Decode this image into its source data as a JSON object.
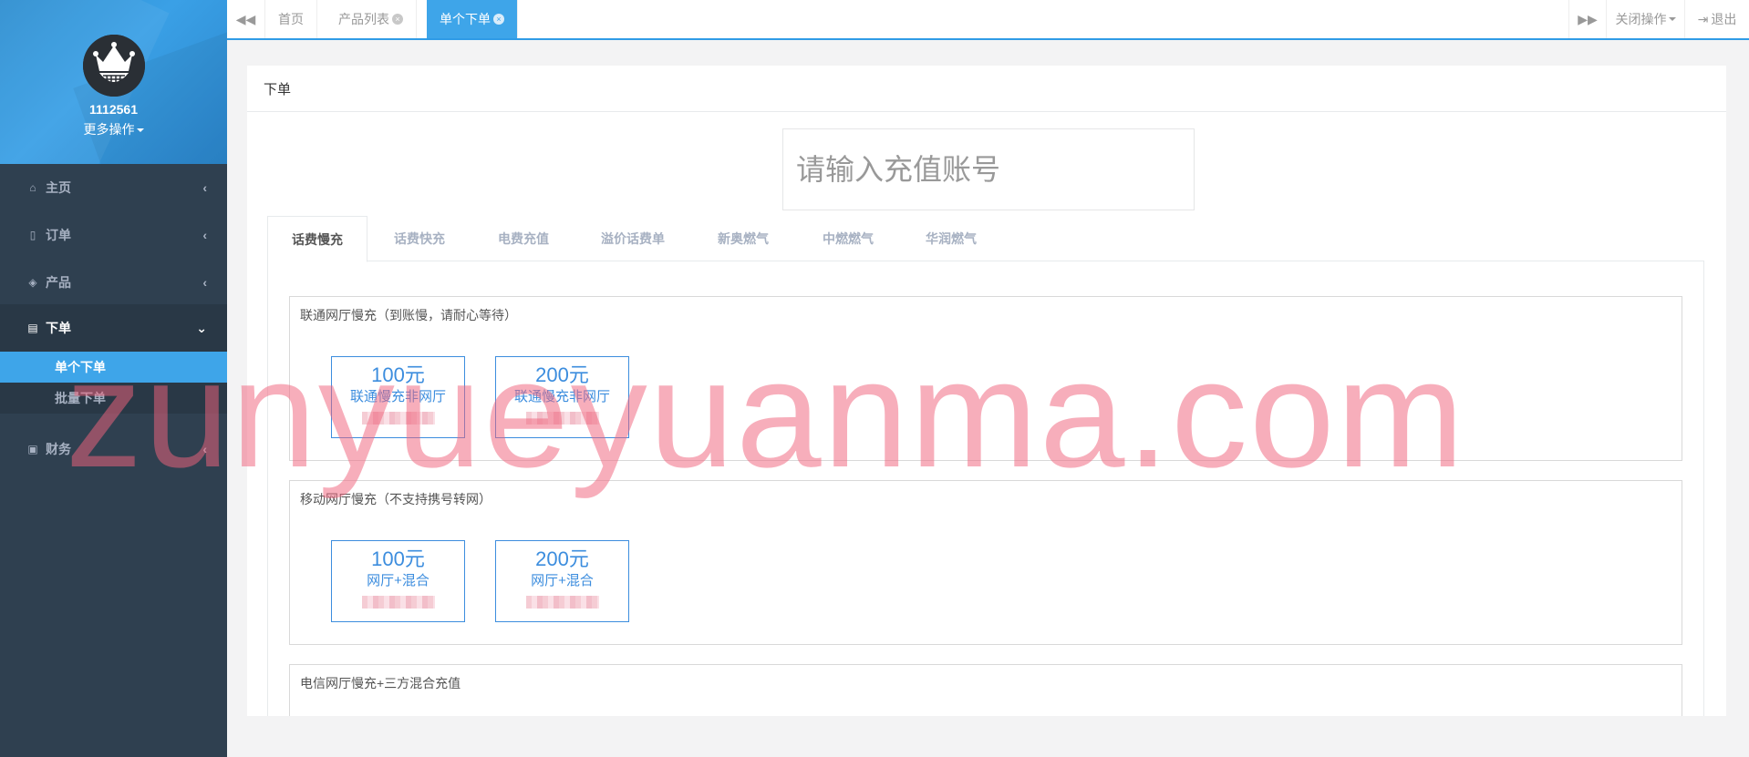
{
  "user": {
    "name": "1112561",
    "more_ops": "更多操作"
  },
  "sidebar": {
    "items": [
      {
        "label": "主页",
        "icon": "home-icon",
        "chevron": "‹"
      },
      {
        "label": "订单",
        "icon": "file-icon",
        "chevron": "‹"
      },
      {
        "label": "产品",
        "icon": "cube-icon",
        "chevron": "‹"
      },
      {
        "label": "下单",
        "icon": "file-text-icon",
        "chevron": "⌄",
        "expanded": true
      },
      {
        "label": "财务",
        "icon": "money-icon",
        "chevron": "‹"
      }
    ],
    "sub_items": [
      {
        "label": "单个下单",
        "selected": true
      },
      {
        "label": "批量下单",
        "selected": false
      }
    ]
  },
  "topbar": {
    "tabs": [
      {
        "label": "首页"
      },
      {
        "label": "产品列表"
      },
      {
        "label": "单个下单",
        "active": true
      }
    ],
    "close_ops": "关闭操作",
    "logout": "退出"
  },
  "panel": {
    "title": "下单",
    "account_placeholder": "请输入充值账号"
  },
  "product_tabs": [
    "话费慢充",
    "话费快充",
    "电费充值",
    "溢价话费单",
    "新奥燃气",
    "中燃燃气",
    "华润燃气"
  ],
  "groups": [
    {
      "title": "联通网厅慢充（到账慢，请耐心等待）",
      "cards": [
        {
          "amount": "100元",
          "name": "联通慢充非网厅"
        },
        {
          "amount": "200元",
          "name": "联通慢充非网厅"
        }
      ]
    },
    {
      "title": "移动网厅慢充（不支持携号转网）",
      "cards": [
        {
          "amount": "100元",
          "name": "网厅+混合"
        },
        {
          "amount": "200元",
          "name": "网厅+混合"
        }
      ]
    },
    {
      "title": "电信网厅慢充+三方混合充值",
      "cards": []
    }
  ],
  "watermark": "zunyueyuanma.com",
  "colors": {
    "accent": "#3ea5e9",
    "sidebar": "#2f4050",
    "card_blue": "#3c8dde"
  }
}
